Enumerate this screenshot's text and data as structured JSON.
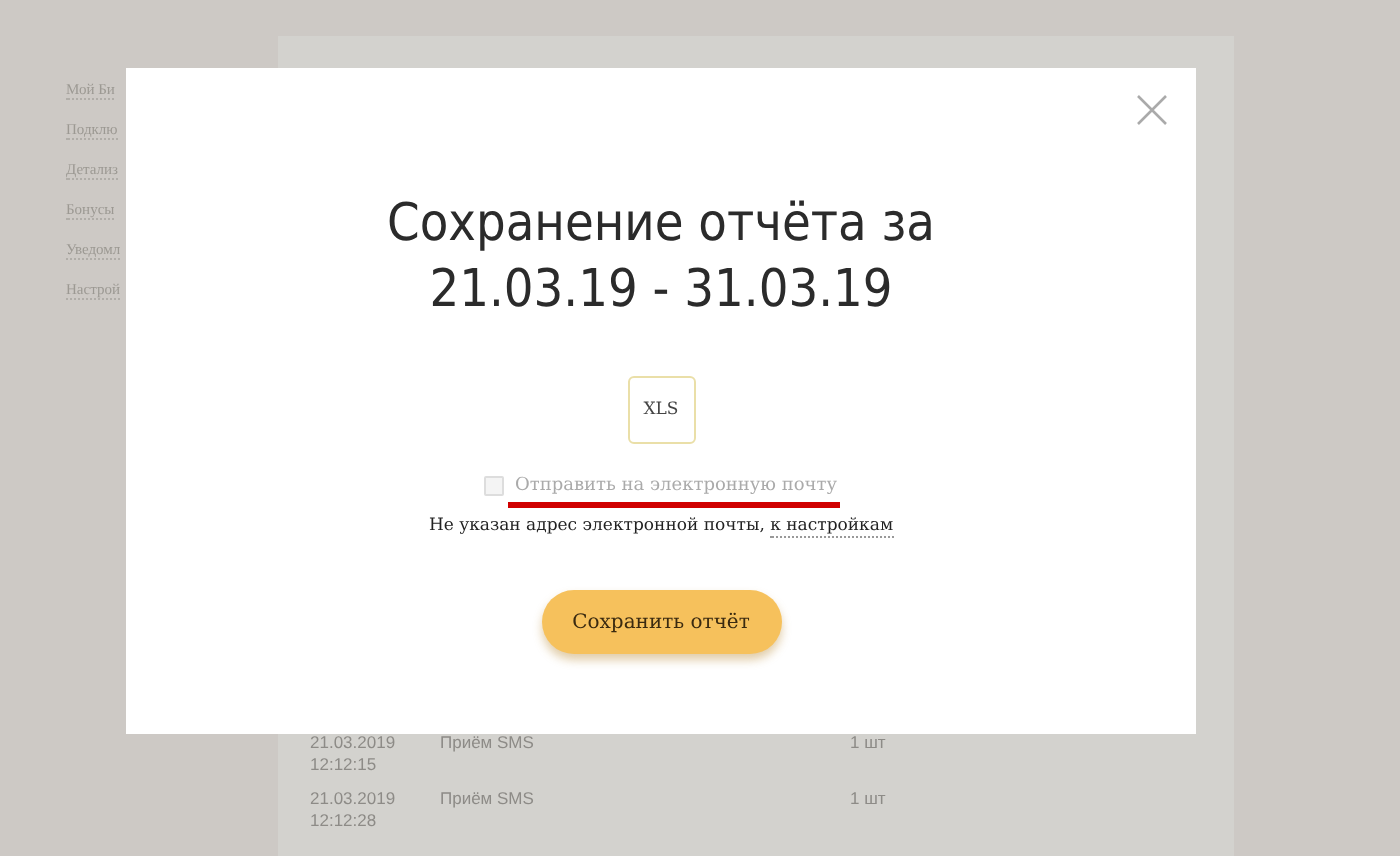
{
  "sidebar": {
    "items": [
      {
        "label": "Мой Би"
      },
      {
        "label": "Подклю"
      },
      {
        "label": "Детализ"
      },
      {
        "label": "Бонусы"
      },
      {
        "label": "Уведомл"
      },
      {
        "label": "Настрой"
      }
    ]
  },
  "table": {
    "rows": [
      {
        "date": "21.03.2019",
        "time": "12:12:15",
        "service": "Приём SMS",
        "quantity": "1 шт"
      },
      {
        "date": "21.03.2019",
        "time": "12:12:28",
        "service": "Приём SMS",
        "quantity": "1 шт"
      }
    ]
  },
  "dialog": {
    "title_line_1": "Сохранение отчёта за",
    "title_line_2": "21.03.19 - 31.03.19",
    "format": "XLS",
    "email_option": {
      "label": "Отправить на электронную почту",
      "checked": false,
      "disabled": true
    },
    "note": "Не указан адрес электронной почты,",
    "note_link": "к настройкам",
    "save_button": "Сохранить отчёт"
  }
}
